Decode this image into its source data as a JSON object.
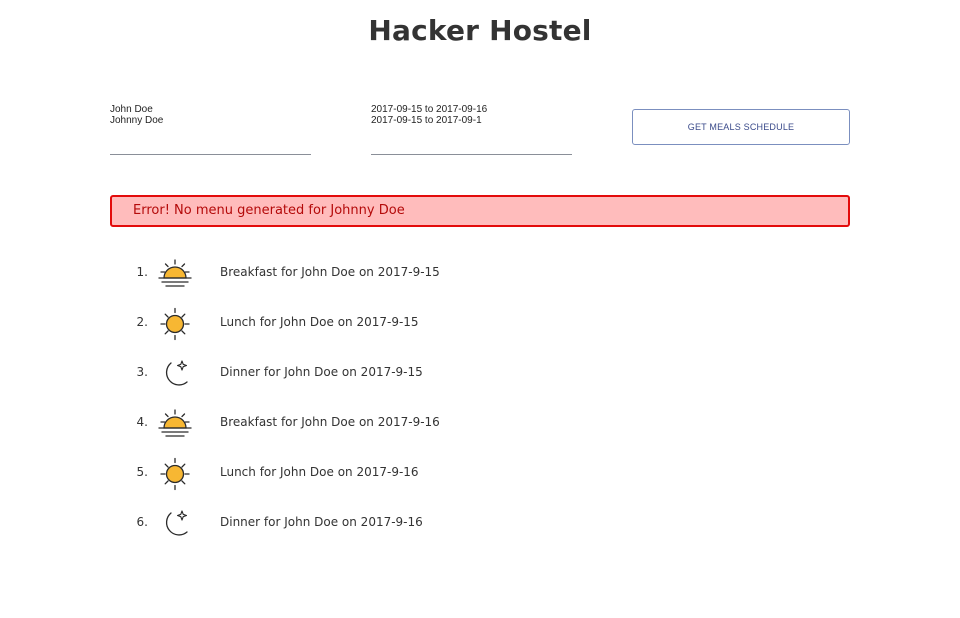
{
  "app": {
    "title": "Hacker Hostel"
  },
  "inputs": {
    "names_value": "John Doe\nJohnny Doe",
    "dates_value": "2017-09-15 to 2017-09-16\n2017-09-15 to 2017-09-1"
  },
  "actions": {
    "get_schedule_label": "GET MEALS SCHEDULE"
  },
  "alert": {
    "message": "Error! No menu generated for Johnny Doe"
  },
  "meals": [
    {
      "number": "1.",
      "icon": "sunrise-icon",
      "text": "Breakfast for John Doe on 2017-9-15"
    },
    {
      "number": "2.",
      "icon": "sun-icon",
      "text": "Lunch for John Doe on 2017-9-15"
    },
    {
      "number": "3.",
      "icon": "moon-icon",
      "text": "Dinner for John Doe on 2017-9-15"
    },
    {
      "number": "4.",
      "icon": "sunrise-icon",
      "text": "Breakfast for John Doe on 2017-9-16"
    },
    {
      "number": "5.",
      "icon": "sun-icon",
      "text": "Lunch for John Doe on 2017-9-16"
    },
    {
      "number": "6.",
      "icon": "moon-icon",
      "text": "Dinner for John Doe on 2017-9-16"
    }
  ],
  "colors": {
    "alert_background": "#ffbcbc",
    "alert_border": "#e30b0b",
    "button_border": "#7b8fbf",
    "icon_fill": "#f7b733",
    "icon_stroke": "#2b2b2b"
  }
}
